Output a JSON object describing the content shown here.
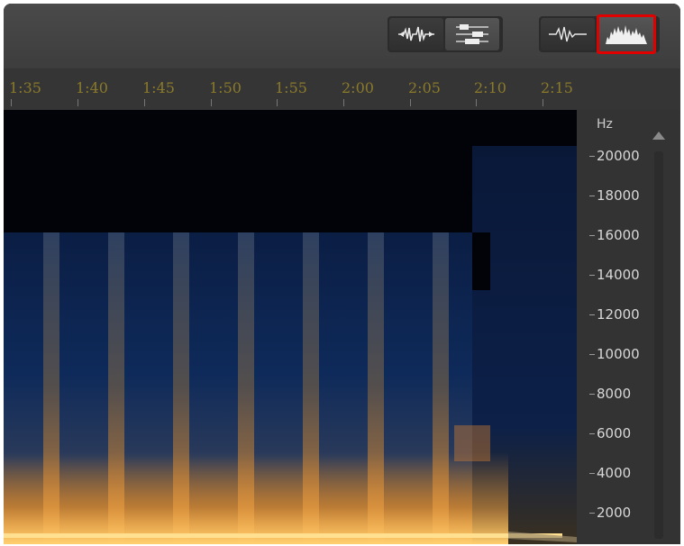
{
  "toolbar": {
    "view_buttons": [
      {
        "icon": "waveform-clip-icon"
      },
      {
        "icon": "multitrack-lanes-icon"
      }
    ],
    "display_buttons": [
      {
        "icon": "waveform-display-icon"
      },
      {
        "icon": "spectral-display-icon",
        "highlighted": true
      }
    ],
    "highlight_color": "#e00000"
  },
  "timeline": {
    "labels": [
      "1:35",
      "1:40",
      "1:45",
      "1:50",
      "1:55",
      "2:00",
      "2:05",
      "2:10",
      "2:15"
    ],
    "label_color": "#8a7a2a"
  },
  "frequency_axis": {
    "unit": "Hz",
    "labels": [
      "20000",
      "18000",
      "16000",
      "14000",
      "12000",
      "10000",
      "8000",
      "6000",
      "4000",
      "2000"
    ]
  },
  "spectrogram": {
    "palette": {
      "background": "#020308",
      "low": "#0c2a58",
      "high": "#f0a040"
    }
  }
}
